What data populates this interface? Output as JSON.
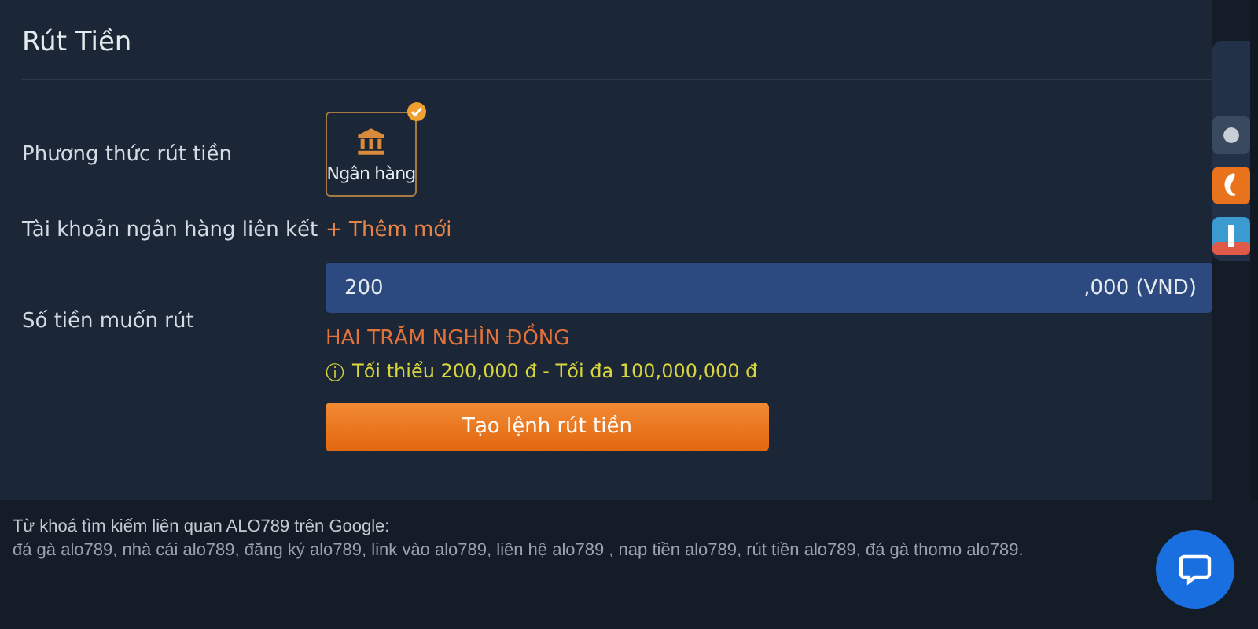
{
  "title": "Rút Tiền",
  "method": {
    "label": "Phương thức rút tiền",
    "options": [
      {
        "label": "Ngân hàng",
        "selected": true
      }
    ]
  },
  "account": {
    "label": "Tài khoản ngân hàng liên kết",
    "link": "+ Thêm mới"
  },
  "amount": {
    "label": "Số tiền muốn rút",
    "value": "200",
    "suffix": ",000 (VND)",
    "words": "HAI TRĂM NGHÌN ĐỒNG",
    "hint_icon": "ⓘ",
    "hint": "Tối thiểu 200,000 đ - Tối đa 100,000,000 đ"
  },
  "submit": "Tạo lệnh rút tiền",
  "footer": {
    "heading": "Từ khoá tìm kiếm liên quan ALO789 trên Google:",
    "keywords": "đá gà alo789, nhà cái alo789, đăng ký alo789, link vào alo789, liên hệ alo789 , nap tiền alo789, rút tiền alo789, đá gà thomo alo789."
  }
}
